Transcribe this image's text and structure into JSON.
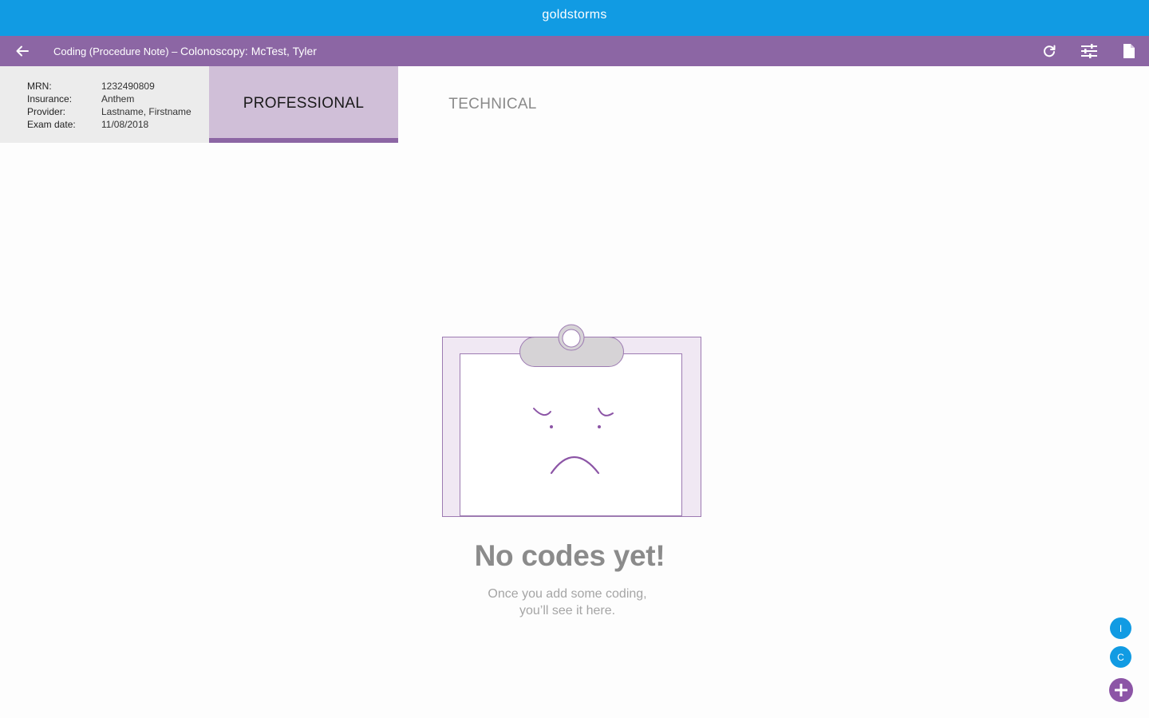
{
  "app_bar": {
    "title": "goldstorms"
  },
  "toolbar": {
    "title_prefix": "Coding (Procedure Note) – ",
    "title_main": "Colonoscopy: McTest, Tyler",
    "icons": [
      "back-arrow-icon",
      "refresh-icon",
      "filter-sliders-icon",
      "document-icon"
    ]
  },
  "patient_info": {
    "rows": [
      {
        "label": "MRN:",
        "value": "1232490809"
      },
      {
        "label": "Insurance:",
        "value": "Anthem"
      },
      {
        "label": "Provider:",
        "value": "Lastname, Firstname"
      },
      {
        "label": "Exam date:",
        "value": "11/08/2018"
      }
    ]
  },
  "tabs": [
    {
      "label": "PROFESSIONAL",
      "active": true
    },
    {
      "label": "TECHNICAL",
      "active": false
    }
  ],
  "empty_state": {
    "icon": "sad-clipboard-icon",
    "title": "No codes yet!",
    "subtitle_line1": "Once you add some coding,",
    "subtitle_line2": "you’ll see it here."
  },
  "fabs": [
    {
      "label": "I"
    },
    {
      "label": "C"
    }
  ],
  "colors": {
    "app_bar": "#119be3",
    "toolbar": "#8c66a4",
    "active_tab": "#d0bfd8",
    "accent": "#8c55a6"
  }
}
